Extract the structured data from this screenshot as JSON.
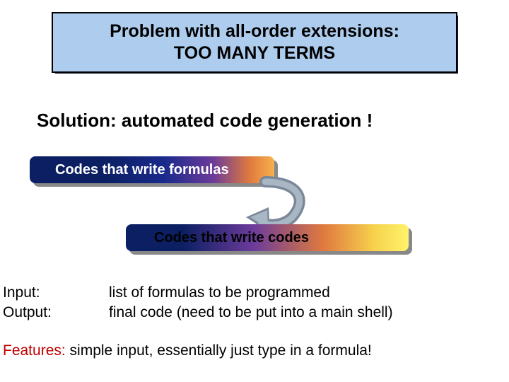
{
  "title": {
    "line1": "Problem with all-order extensions:",
    "line2": "TOO MANY TERMS"
  },
  "solution": "Solution: automated code generation !",
  "pill1": "Codes that write formulas",
  "pill2": "Codes that write codes",
  "io": {
    "input_label": "Input:",
    "input_text": "list of formulas to be programmed",
    "output_label": "Output:",
    "output_text": "final code (need to be put into a main shell)"
  },
  "features": {
    "label": "Features:",
    "text": " simple input, essentially just type in a formula!"
  }
}
